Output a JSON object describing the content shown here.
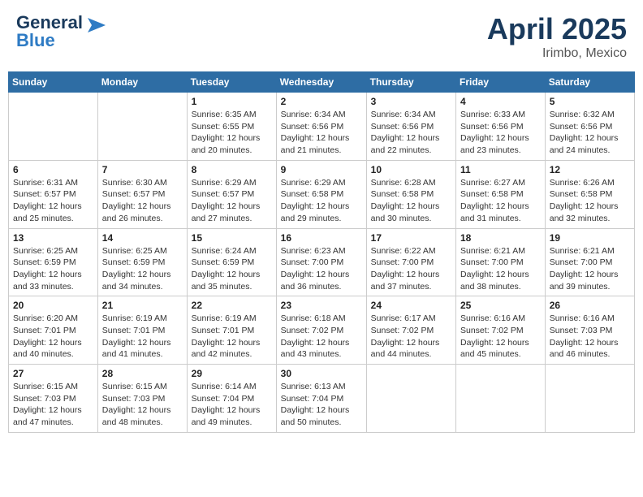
{
  "header": {
    "logo_line1": "General",
    "logo_line2": "Blue",
    "title": "April 2025",
    "subtitle": "Irimbo, Mexico"
  },
  "days_of_week": [
    "Sunday",
    "Monday",
    "Tuesday",
    "Wednesday",
    "Thursday",
    "Friday",
    "Saturday"
  ],
  "weeks": [
    [
      {
        "day": "",
        "detail": []
      },
      {
        "day": "",
        "detail": []
      },
      {
        "day": "1",
        "detail": [
          "Sunrise: 6:35 AM",
          "Sunset: 6:55 PM",
          "Daylight: 12 hours",
          "and 20 minutes."
        ]
      },
      {
        "day": "2",
        "detail": [
          "Sunrise: 6:34 AM",
          "Sunset: 6:56 PM",
          "Daylight: 12 hours",
          "and 21 minutes."
        ]
      },
      {
        "day": "3",
        "detail": [
          "Sunrise: 6:34 AM",
          "Sunset: 6:56 PM",
          "Daylight: 12 hours",
          "and 22 minutes."
        ]
      },
      {
        "day": "4",
        "detail": [
          "Sunrise: 6:33 AM",
          "Sunset: 6:56 PM",
          "Daylight: 12 hours",
          "and 23 minutes."
        ]
      },
      {
        "day": "5",
        "detail": [
          "Sunrise: 6:32 AM",
          "Sunset: 6:56 PM",
          "Daylight: 12 hours",
          "and 24 minutes."
        ]
      }
    ],
    [
      {
        "day": "6",
        "detail": [
          "Sunrise: 6:31 AM",
          "Sunset: 6:57 PM",
          "Daylight: 12 hours",
          "and 25 minutes."
        ]
      },
      {
        "day": "7",
        "detail": [
          "Sunrise: 6:30 AM",
          "Sunset: 6:57 PM",
          "Daylight: 12 hours",
          "and 26 minutes."
        ]
      },
      {
        "day": "8",
        "detail": [
          "Sunrise: 6:29 AM",
          "Sunset: 6:57 PM",
          "Daylight: 12 hours",
          "and 27 minutes."
        ]
      },
      {
        "day": "9",
        "detail": [
          "Sunrise: 6:29 AM",
          "Sunset: 6:58 PM",
          "Daylight: 12 hours",
          "and 29 minutes."
        ]
      },
      {
        "day": "10",
        "detail": [
          "Sunrise: 6:28 AM",
          "Sunset: 6:58 PM",
          "Daylight: 12 hours",
          "and 30 minutes."
        ]
      },
      {
        "day": "11",
        "detail": [
          "Sunrise: 6:27 AM",
          "Sunset: 6:58 PM",
          "Daylight: 12 hours",
          "and 31 minutes."
        ]
      },
      {
        "day": "12",
        "detail": [
          "Sunrise: 6:26 AM",
          "Sunset: 6:58 PM",
          "Daylight: 12 hours",
          "and 32 minutes."
        ]
      }
    ],
    [
      {
        "day": "13",
        "detail": [
          "Sunrise: 6:25 AM",
          "Sunset: 6:59 PM",
          "Daylight: 12 hours",
          "and 33 minutes."
        ]
      },
      {
        "day": "14",
        "detail": [
          "Sunrise: 6:25 AM",
          "Sunset: 6:59 PM",
          "Daylight: 12 hours",
          "and 34 minutes."
        ]
      },
      {
        "day": "15",
        "detail": [
          "Sunrise: 6:24 AM",
          "Sunset: 6:59 PM",
          "Daylight: 12 hours",
          "and 35 minutes."
        ]
      },
      {
        "day": "16",
        "detail": [
          "Sunrise: 6:23 AM",
          "Sunset: 7:00 PM",
          "Daylight: 12 hours",
          "and 36 minutes."
        ]
      },
      {
        "day": "17",
        "detail": [
          "Sunrise: 6:22 AM",
          "Sunset: 7:00 PM",
          "Daylight: 12 hours",
          "and 37 minutes."
        ]
      },
      {
        "day": "18",
        "detail": [
          "Sunrise: 6:21 AM",
          "Sunset: 7:00 PM",
          "Daylight: 12 hours",
          "and 38 minutes."
        ]
      },
      {
        "day": "19",
        "detail": [
          "Sunrise: 6:21 AM",
          "Sunset: 7:00 PM",
          "Daylight: 12 hours",
          "and 39 minutes."
        ]
      }
    ],
    [
      {
        "day": "20",
        "detail": [
          "Sunrise: 6:20 AM",
          "Sunset: 7:01 PM",
          "Daylight: 12 hours",
          "and 40 minutes."
        ]
      },
      {
        "day": "21",
        "detail": [
          "Sunrise: 6:19 AM",
          "Sunset: 7:01 PM",
          "Daylight: 12 hours",
          "and 41 minutes."
        ]
      },
      {
        "day": "22",
        "detail": [
          "Sunrise: 6:19 AM",
          "Sunset: 7:01 PM",
          "Daylight: 12 hours",
          "and 42 minutes."
        ]
      },
      {
        "day": "23",
        "detail": [
          "Sunrise: 6:18 AM",
          "Sunset: 7:02 PM",
          "Daylight: 12 hours",
          "and 43 minutes."
        ]
      },
      {
        "day": "24",
        "detail": [
          "Sunrise: 6:17 AM",
          "Sunset: 7:02 PM",
          "Daylight: 12 hours",
          "and 44 minutes."
        ]
      },
      {
        "day": "25",
        "detail": [
          "Sunrise: 6:16 AM",
          "Sunset: 7:02 PM",
          "Daylight: 12 hours",
          "and 45 minutes."
        ]
      },
      {
        "day": "26",
        "detail": [
          "Sunrise: 6:16 AM",
          "Sunset: 7:03 PM",
          "Daylight: 12 hours",
          "and 46 minutes."
        ]
      }
    ],
    [
      {
        "day": "27",
        "detail": [
          "Sunrise: 6:15 AM",
          "Sunset: 7:03 PM",
          "Daylight: 12 hours",
          "and 47 minutes."
        ]
      },
      {
        "day": "28",
        "detail": [
          "Sunrise: 6:15 AM",
          "Sunset: 7:03 PM",
          "Daylight: 12 hours",
          "and 48 minutes."
        ]
      },
      {
        "day": "29",
        "detail": [
          "Sunrise: 6:14 AM",
          "Sunset: 7:04 PM",
          "Daylight: 12 hours",
          "and 49 minutes."
        ]
      },
      {
        "day": "30",
        "detail": [
          "Sunrise: 6:13 AM",
          "Sunset: 7:04 PM",
          "Daylight: 12 hours",
          "and 50 minutes."
        ]
      },
      {
        "day": "",
        "detail": []
      },
      {
        "day": "",
        "detail": []
      },
      {
        "day": "",
        "detail": []
      }
    ]
  ]
}
